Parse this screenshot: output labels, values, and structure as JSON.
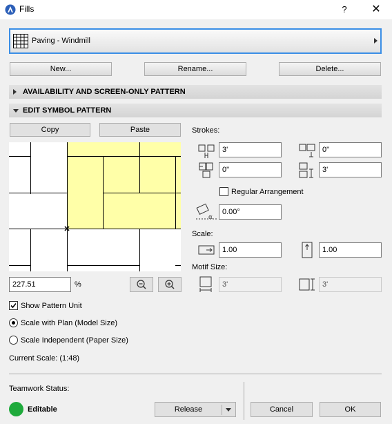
{
  "window": {
    "title": "Fills",
    "help_label": "?",
    "close_label": "✕"
  },
  "selector": {
    "value": "Paving - Windmill"
  },
  "buttons": {
    "new": "New...",
    "rename": "Rename...",
    "delete": "Delete..."
  },
  "sections": {
    "availability": "AVAILABILITY AND SCREEN-ONLY PATTERN",
    "edit_symbol": "EDIT SYMBOL PATTERN"
  },
  "edit": {
    "copy": "Copy",
    "paste": "Paste",
    "zoom_value": "227.51",
    "zoom_unit": "%",
    "show_pattern_unit": "Show Pattern Unit",
    "show_pattern_unit_checked": true,
    "scale_with_plan": "Scale with Plan (Model Size)",
    "scale_independent": "Scale Independent (Paper Size)",
    "scale_mode": "plan",
    "current_scale": "Current Scale: (1:48)"
  },
  "strokes": {
    "label": "Strokes:",
    "horiz_spacing": "3'",
    "vert_offset_right": "0\"",
    "horiz_offset": "0\"",
    "vert_spacing": "3'",
    "regular_arrangement": "Regular Arrangement",
    "regular_arrangement_checked": false,
    "angle": "0.00°"
  },
  "scale": {
    "label": "Scale:",
    "x": "1.00",
    "y": "1.00"
  },
  "motif": {
    "label": "Motif Size:",
    "width": "3'",
    "height": "3'"
  },
  "teamwork": {
    "label": "Teamwork Status:",
    "status": "Editable",
    "status_color": "#1faa3c"
  },
  "footer": {
    "release": "Release",
    "cancel": "Cancel",
    "ok": "OK"
  },
  "colors": {
    "accent": "#3a8ee6",
    "pattern_highlight": "#ffffa8"
  }
}
